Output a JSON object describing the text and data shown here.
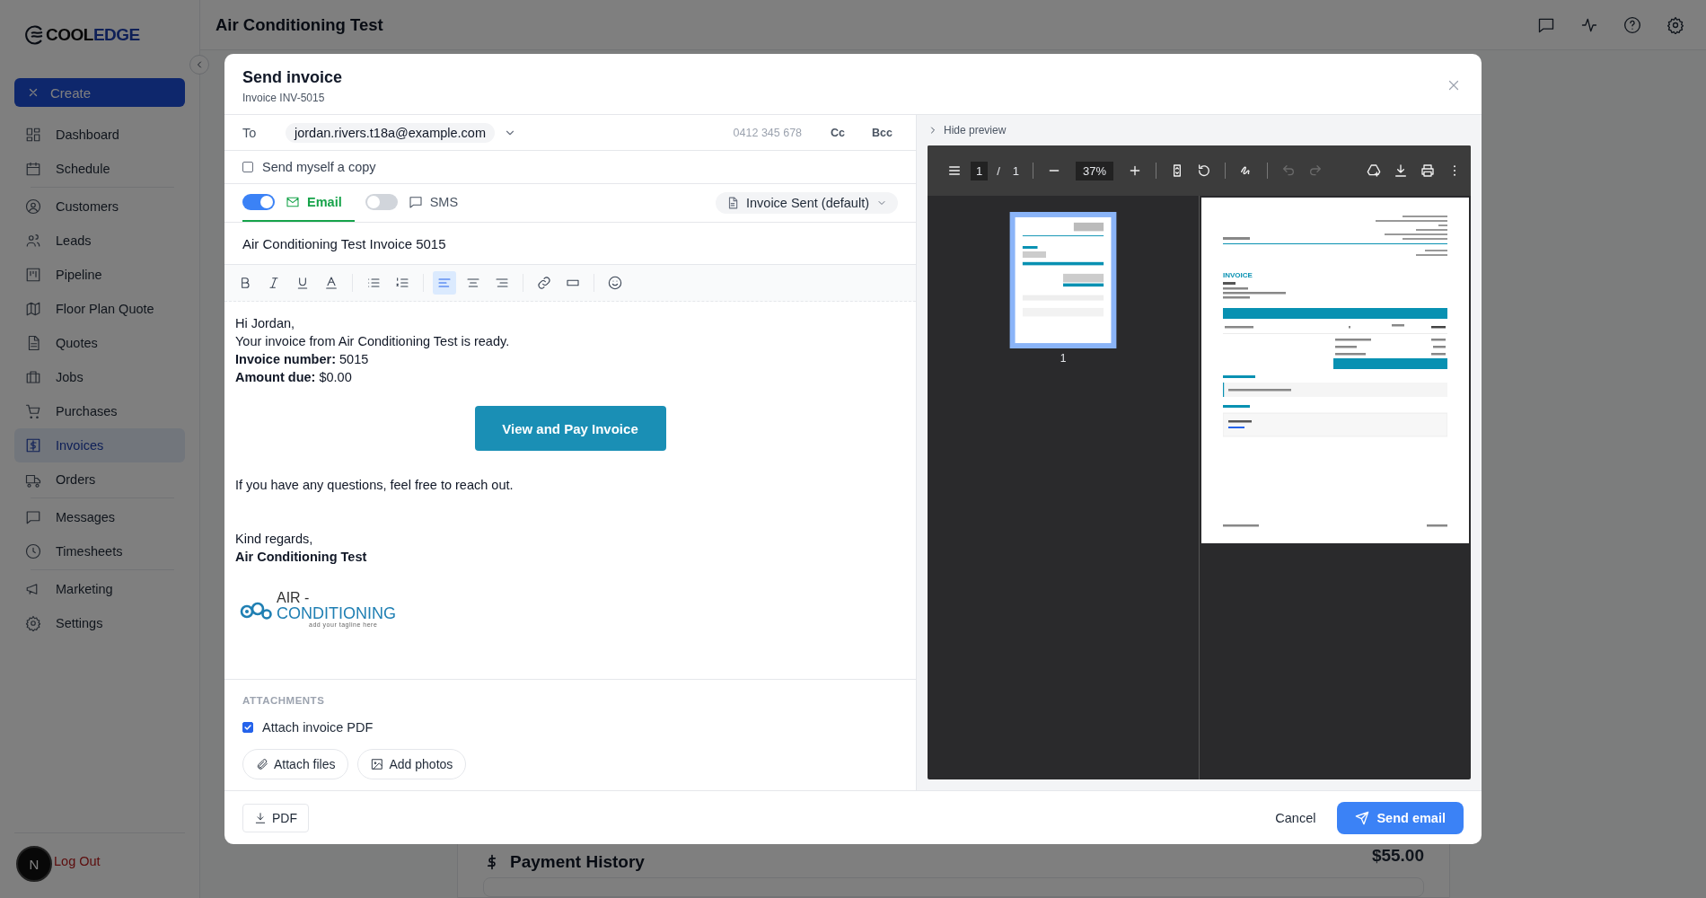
{
  "app": {
    "logo_dark": "COOL",
    "logo_blue": "EDGE",
    "title": "Air Conditioning Test"
  },
  "sidebar": {
    "create": "Create",
    "groups": [
      [
        {
          "label": "Dashboard",
          "selected": false
        },
        {
          "label": "Schedule",
          "selected": false
        }
      ],
      [
        {
          "label": "Customers",
          "selected": false
        },
        {
          "label": "Leads",
          "selected": false
        },
        {
          "label": "Pipeline",
          "selected": false
        },
        {
          "label": "Floor Plan Quote",
          "selected": false
        },
        {
          "label": "Quotes",
          "selected": false
        },
        {
          "label": "Jobs",
          "selected": false
        },
        {
          "label": "Purchases",
          "selected": false
        },
        {
          "label": "Invoices",
          "selected": true
        },
        {
          "label": "Orders",
          "selected": false
        }
      ],
      [
        {
          "label": "Messages",
          "selected": false
        },
        {
          "label": "Timesheets",
          "selected": false
        }
      ],
      [
        {
          "label": "Marketing",
          "selected": false
        },
        {
          "label": "Settings",
          "selected": false
        }
      ]
    ],
    "avatar": "N",
    "logout": "Log Out"
  },
  "page": {
    "section": "Payment History",
    "total": "$55.00"
  },
  "modal": {
    "title": "Send invoice",
    "subtitle": "Invoice INV-5015",
    "to_label": "To",
    "recipient": "jordan.rivers.t18a@example.com",
    "phone": "0412 345 678",
    "cc": "Cc",
    "bcc": "Bcc",
    "copy": {
      "label": "Send myself a copy",
      "checked": false
    },
    "channels": [
      {
        "kind": "email",
        "label": "Email",
        "on": true,
        "selected": true
      },
      {
        "kind": "sms",
        "label": "SMS",
        "on": false,
        "selected": false
      }
    ],
    "template": "Invoice Sent (default)",
    "subject": "Air Conditioning Test Invoice 5015",
    "toolbar": [
      [
        {
          "kind": "bold",
          "selected": false
        },
        {
          "kind": "italic",
          "selected": false
        },
        {
          "kind": "underline",
          "selected": false
        },
        {
          "kind": "textcolor",
          "selected": false
        }
      ],
      [
        {
          "kind": "list",
          "selected": false
        },
        {
          "kind": "olist",
          "selected": false
        }
      ],
      [
        {
          "kind": "alignleft",
          "selected": true
        },
        {
          "kind": "aligncenter",
          "selected": false
        },
        {
          "kind": "alignright",
          "selected": false
        }
      ],
      [
        {
          "kind": "link",
          "selected": false
        },
        {
          "kind": "buttonrect",
          "selected": false
        }
      ],
      [
        {
          "kind": "smile",
          "selected": false
        }
      ]
    ],
    "body": {
      "greeting": "Hi Jordan,",
      "intro": "Your invoice from Air Conditioning Test is ready.",
      "number": "**Invoice number:** 5015",
      "amount": "**Amount due:** $0.00",
      "button": "View and Pay Invoice",
      "question": "If you have any questions, feel free to reach out.",
      "regards": "Kind regards,",
      "signature": "Air Conditioning Test",
      "logo_line1": "AIR -",
      "logo_line2": "CONDITIONING",
      "logo_tagline": "add your tagline here"
    },
    "attachments": {
      "heading": "ATTACHMENTS",
      "pdf": {
        "label": "Attach invoice PDF",
        "checked": true
      },
      "buttons": [
        {
          "kind": "files",
          "label": "Attach files"
        },
        {
          "kind": "photos",
          "label": "Add photos"
        }
      ]
    },
    "preview": {
      "toggle": "Hide preview",
      "page": "1",
      "slash": "/",
      "pages": "1",
      "zoom": "37%",
      "tools": [
        [
          {
            "kind": "fit",
            "disabled": false
          },
          {
            "kind": "rotate",
            "disabled": false
          }
        ],
        [
          {
            "kind": "draw",
            "disabled": false
          }
        ],
        [
          {
            "kind": "undo",
            "disabled": true
          },
          {
            "kind": "redo",
            "disabled": true
          }
        ]
      ],
      "actions": [
        {
          "kind": "drive"
        },
        {
          "kind": "download"
        },
        {
          "kind": "print"
        },
        {
          "kind": "more"
        }
      ],
      "thumbnails": [
        {
          "label": "1",
          "selected": true
        }
      ],
      "document": {
        "heading": "INVOICE"
      }
    },
    "footer": {
      "pdf": "PDF",
      "cancel": "Cancel",
      "send": "Send email"
    }
  }
}
